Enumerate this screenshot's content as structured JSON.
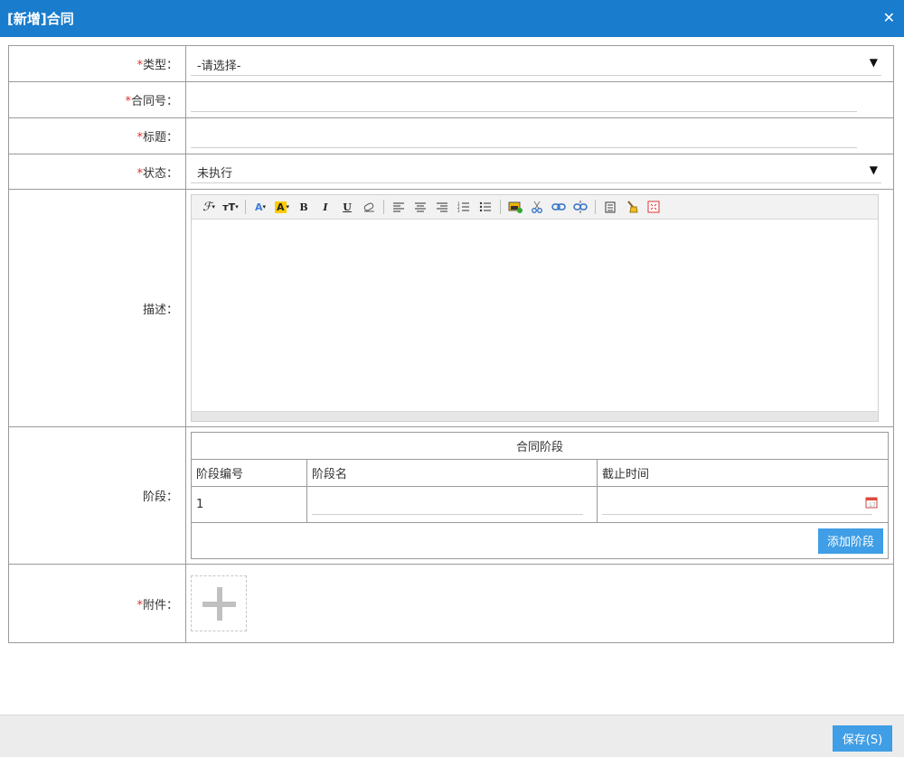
{
  "window": {
    "title": "[新增]合同",
    "close_icon": "close-icon"
  },
  "form": {
    "type": {
      "label": "类型：",
      "required_mark": "*",
      "value": "-请选择-"
    },
    "contract_no": {
      "label": "合同号：",
      "required_mark": "*",
      "value": ""
    },
    "title": {
      "label": "标题：",
      "required_mark": "*",
      "value": ""
    },
    "status": {
      "label": "状态：",
      "required_mark": "*",
      "value": "未执行"
    },
    "description": {
      "label": "描述："
    },
    "stages": {
      "label": "阶段：",
      "caption": "合同阶段",
      "headers": [
        "阶段编号",
        "阶段名",
        "截止时间"
      ],
      "rows": [
        {
          "number": "1",
          "name": "",
          "deadline": ""
        }
      ],
      "add_label": "添加阶段"
    },
    "attachment": {
      "label": "附件：",
      "required_mark": "*"
    }
  },
  "editor_toolbar": [
    "font-family-icon",
    "font-size-icon",
    "font-color-icon",
    "highlight-color-icon",
    "bold-icon",
    "italic-icon",
    "underline-icon",
    "eraser-icon",
    "align-left-icon",
    "align-center-icon",
    "align-right-icon",
    "ordered-list-icon",
    "unordered-list-icon",
    "insert-image-icon",
    "cut-icon",
    "link-icon",
    "unlink-icon",
    "paste-text-icon",
    "clear-format-icon",
    "fullscreen-icon"
  ],
  "footer": {
    "save_label": "保存(S)"
  },
  "colors": {
    "titlebar": "#1a7ccc",
    "button": "#3f9ee5",
    "required": "#e0302f"
  }
}
